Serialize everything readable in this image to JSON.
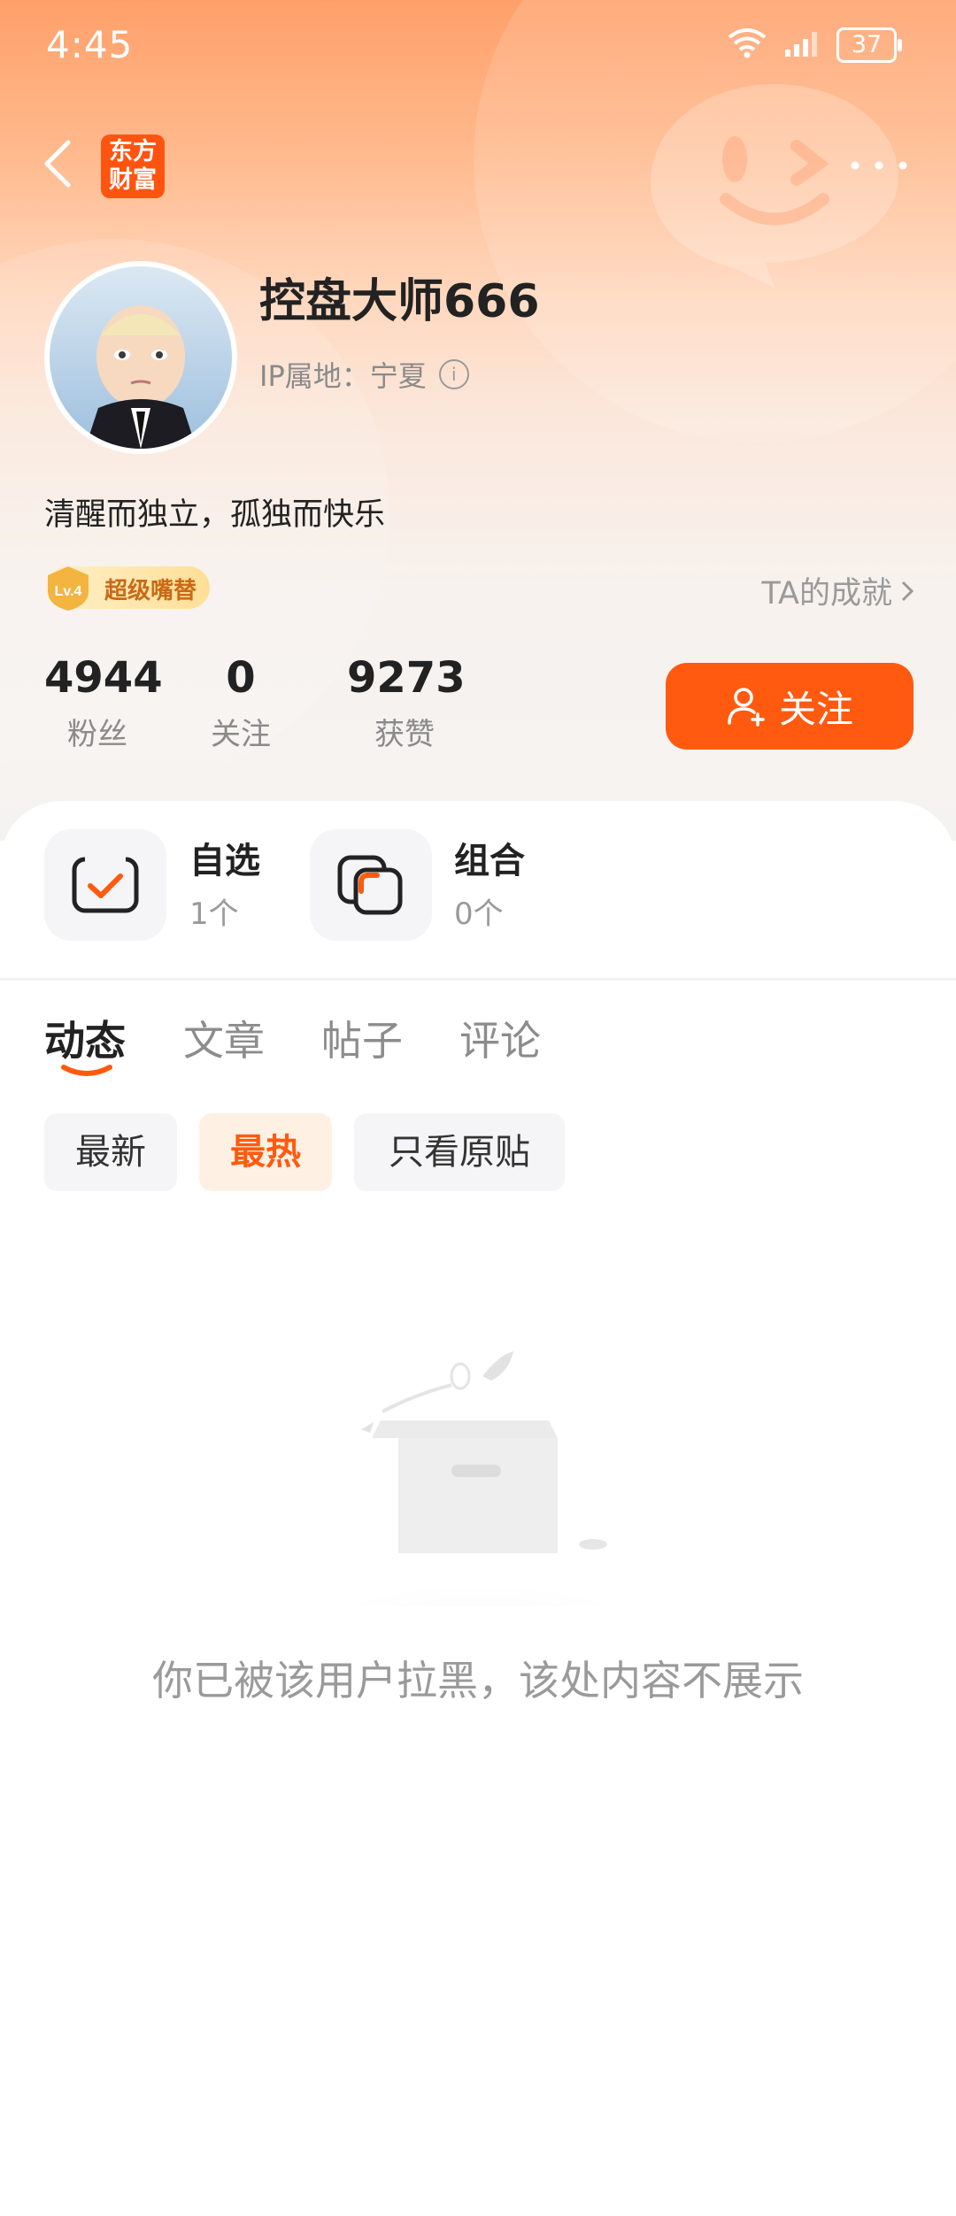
{
  "status_bar": {
    "time": "4:45",
    "battery": "37"
  },
  "header": {
    "logo_text": "东方\n财富"
  },
  "profile": {
    "nickname": "控盘大师666",
    "ip_label": "IP属地：宁夏",
    "bio": "清醒而独立，孤独而快乐",
    "badge_level": "Lv.4",
    "badge_label": "超级嘴替",
    "achievement_link": "TA的成就"
  },
  "stats": [
    {
      "value": "4944",
      "label": "粉丝"
    },
    {
      "value": "0",
      "label": "关注"
    },
    {
      "value": "9273",
      "label": "获赞"
    }
  ],
  "follow_button": "关注",
  "cards": [
    {
      "title": "自选",
      "count": "1个"
    },
    {
      "title": "组合",
      "count": "0个"
    }
  ],
  "tabs": [
    {
      "label": "动态",
      "active": true
    },
    {
      "label": "文章",
      "active": false
    },
    {
      "label": "帖子",
      "active": false
    },
    {
      "label": "评论",
      "active": false
    }
  ],
  "filters": [
    {
      "label": "最新",
      "active": false
    },
    {
      "label": "最热",
      "active": true
    },
    {
      "label": "只看原贴",
      "active": false
    }
  ],
  "empty_message": "你已被该用户拉黑，该处内容不展示",
  "colors": {
    "accent": "#ff5a10",
    "brand": "#ff5410"
  }
}
